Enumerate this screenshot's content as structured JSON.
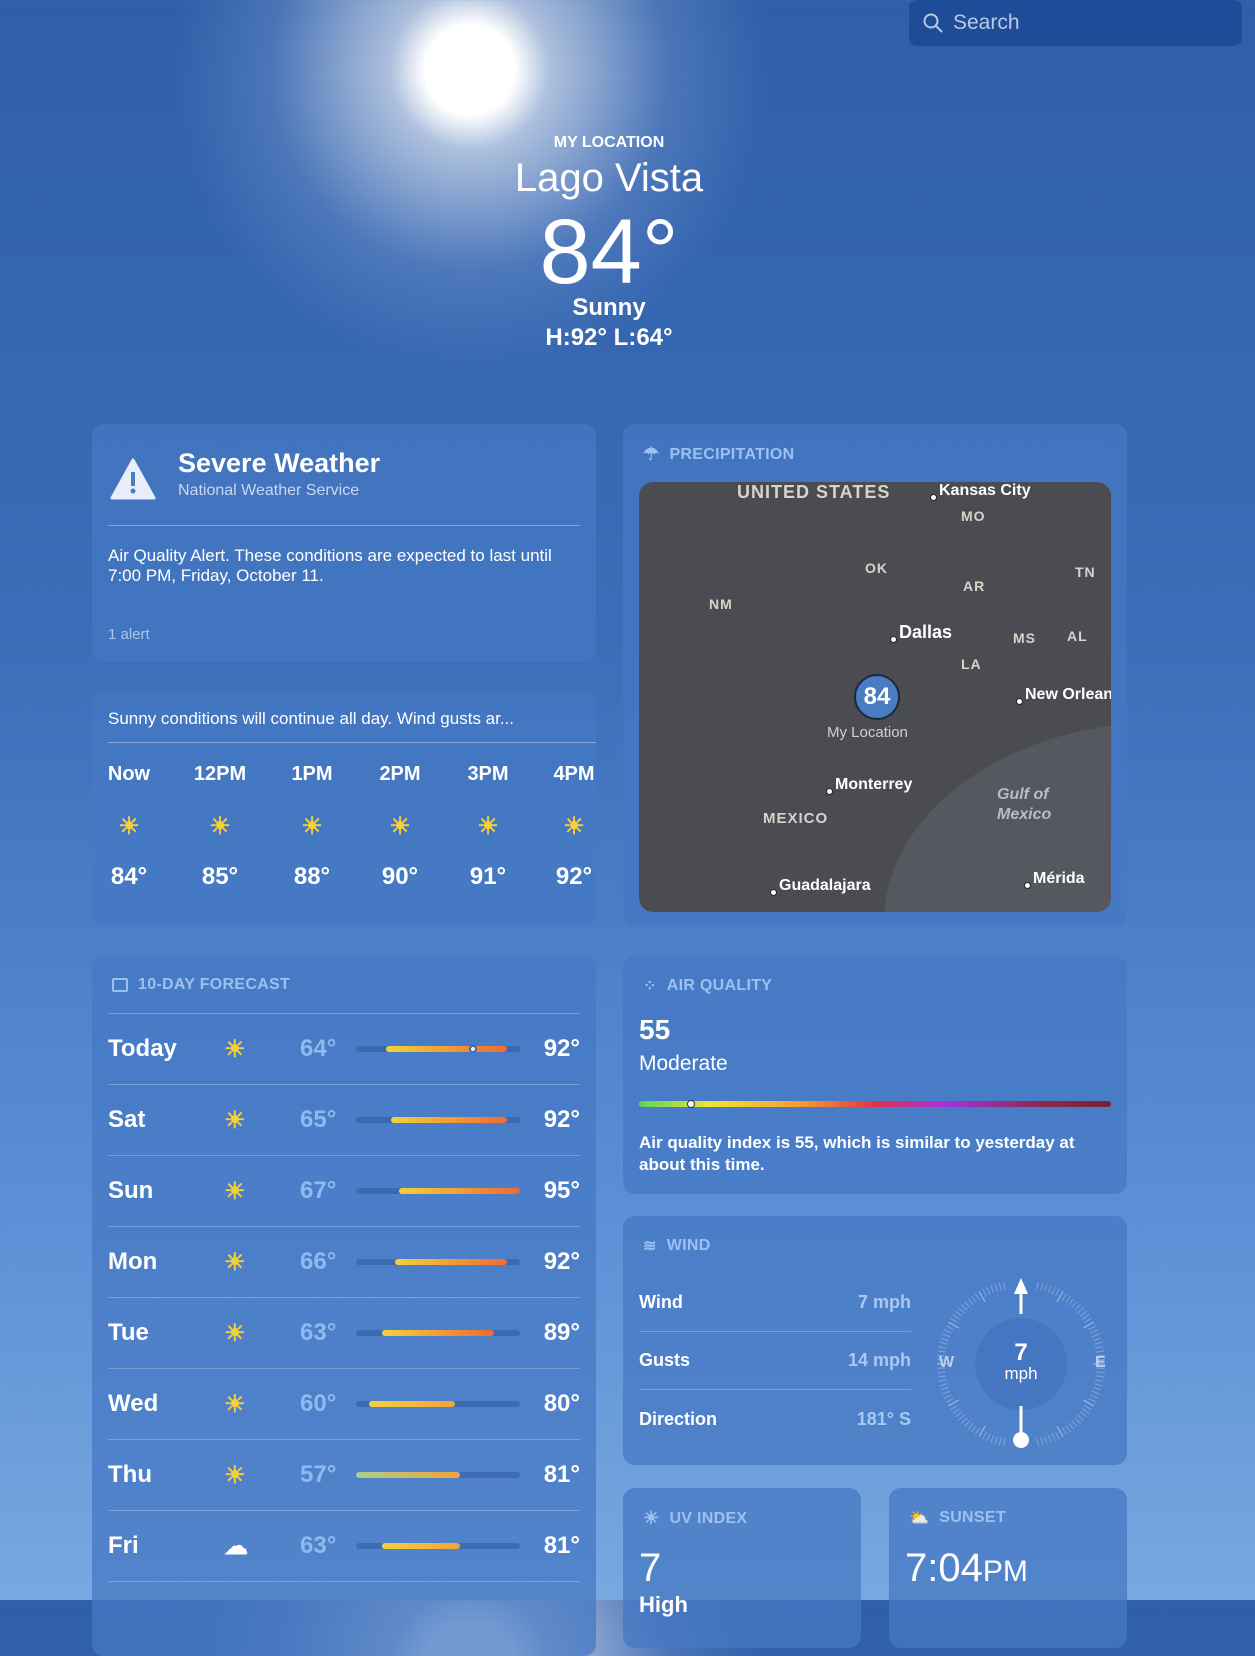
{
  "search": {
    "placeholder": "Search",
    "icon": "search-icon"
  },
  "header": {
    "label": "MY LOCATION",
    "city": "Lago Vista",
    "temp": "84°",
    "condition": "Sunny",
    "hilo": "H:92°  L:64°"
  },
  "alert": {
    "title": "Severe Weather",
    "source": "National Weather Service",
    "text": "Air Quality Alert. These conditions are expected to last until 7:00 PM, Friday, October 11.",
    "count": "1 alert"
  },
  "hourly": {
    "summary": "Sunny conditions will continue all day. Wind gusts ar...",
    "hours": [
      {
        "t": "Now",
        "v": "84°"
      },
      {
        "t": "12PM",
        "v": "85°"
      },
      {
        "t": "1PM",
        "v": "88°"
      },
      {
        "t": "2PM",
        "v": "90°"
      },
      {
        "t": "3PM",
        "v": "91°"
      },
      {
        "t": "4PM",
        "v": "92°"
      }
    ]
  },
  "forecast": {
    "title": "10-DAY FORECAST",
    "range": [
      57,
      95
    ],
    "current": 84,
    "days": [
      {
        "d": "Today",
        "icon": "sun",
        "lo": "64°",
        "hi": "92°",
        "l": 64,
        "h": 92
      },
      {
        "d": "Sat",
        "icon": "sun",
        "lo": "65°",
        "hi": "92°",
        "l": 65,
        "h": 92
      },
      {
        "d": "Sun",
        "icon": "sun",
        "lo": "67°",
        "hi": "95°",
        "l": 67,
        "h": 95
      },
      {
        "d": "Mon",
        "icon": "sun",
        "lo": "66°",
        "hi": "92°",
        "l": 66,
        "h": 92
      },
      {
        "d": "Tue",
        "icon": "sun",
        "lo": "63°",
        "hi": "89°",
        "l": 63,
        "h": 89
      },
      {
        "d": "Wed",
        "icon": "sun",
        "lo": "60°",
        "hi": "80°",
        "l": 60,
        "h": 80
      },
      {
        "d": "Thu",
        "icon": "sun",
        "lo": "57°",
        "hi": "81°",
        "l": 57,
        "h": 81
      },
      {
        "d": "Fri",
        "icon": "cloud",
        "lo": "63°",
        "hi": "81°",
        "l": 63,
        "h": 81
      }
    ]
  },
  "precip": {
    "title": "PRECIPITATION",
    "pin": "84",
    "pin_label": "My Location",
    "labels": [
      "UNITED STATES",
      "Kansas City",
      "MO",
      "OK",
      "AR",
      "TN",
      "NM",
      "Dallas",
      "MS",
      "AL",
      "LA",
      "New Orleans",
      "Monterrey",
      "Gulf of",
      "Mexico",
      "MEXICO",
      "Guadalajara",
      "Mérida"
    ]
  },
  "aq": {
    "title": "AIR QUALITY",
    "value": "55",
    "level": "Moderate",
    "index": 55,
    "text": "Air quality index is 55, which is similar to yesterday at about this time."
  },
  "wind": {
    "title": "WIND",
    "rows": [
      {
        "k": "Wind",
        "v": "7 mph"
      },
      {
        "k": "Gusts",
        "v": "14 mph"
      },
      {
        "k": "Direction",
        "v": "181° S"
      }
    ],
    "speed": "7",
    "unit": "mph",
    "w": "W",
    "e": "E",
    "direction_deg": 181
  },
  "uv": {
    "title": "UV INDEX",
    "value": "7",
    "level": "High"
  },
  "sunset": {
    "title": "SUNSET",
    "time": "7:04",
    "ampm": "PM"
  }
}
